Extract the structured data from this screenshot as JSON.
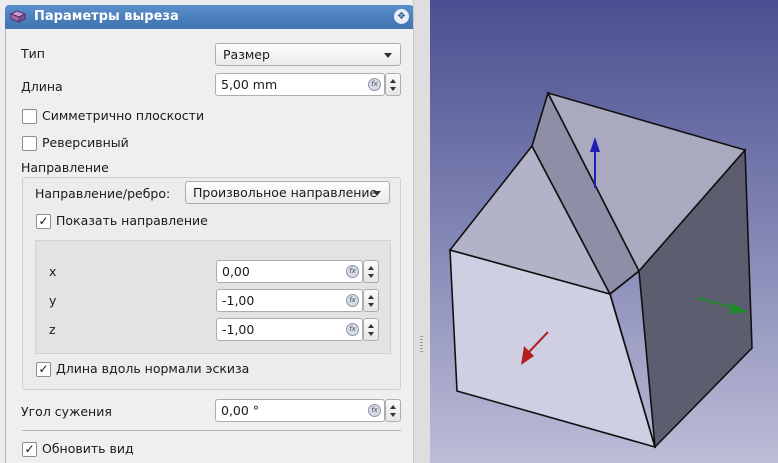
{
  "panel": {
    "title": "Параметры выреза",
    "collapse_glyph": "❖",
    "type_label": "Тип",
    "type_value": "Размер",
    "length_label": "Длина",
    "length_value": "5,00 mm",
    "symmetric_label": "Симметрично плоскости",
    "symmetric_checked": false,
    "reversed_label": "Реверсивный",
    "reversed_checked": false,
    "direction_label": "Направление",
    "direction_edge_label": "Направление/ребро:",
    "direction_edge_value": "Произвольное направление",
    "show_direction_label": "Показать направление",
    "show_direction_check": "✓",
    "x_label": "x",
    "x_value": "0,00",
    "y_label": "y",
    "y_value": "-1,00",
    "z_label": "z",
    "z_value": "-1,00",
    "along_normal_label": "Длина вдоль нормали эскиза",
    "along_normal_check": "✓",
    "taper_label": "Угол сужения",
    "taper_value": "0,00 °",
    "update_view_label": "Обновить вид",
    "update_view_check": "✓"
  },
  "viewport": {
    "background_top": "#4a4f91",
    "background_bottom": "#bdbdd7",
    "axis_colors": {
      "z": "#1f1fb8",
      "x": "#b02020",
      "y": "#1d8a2a"
    }
  }
}
